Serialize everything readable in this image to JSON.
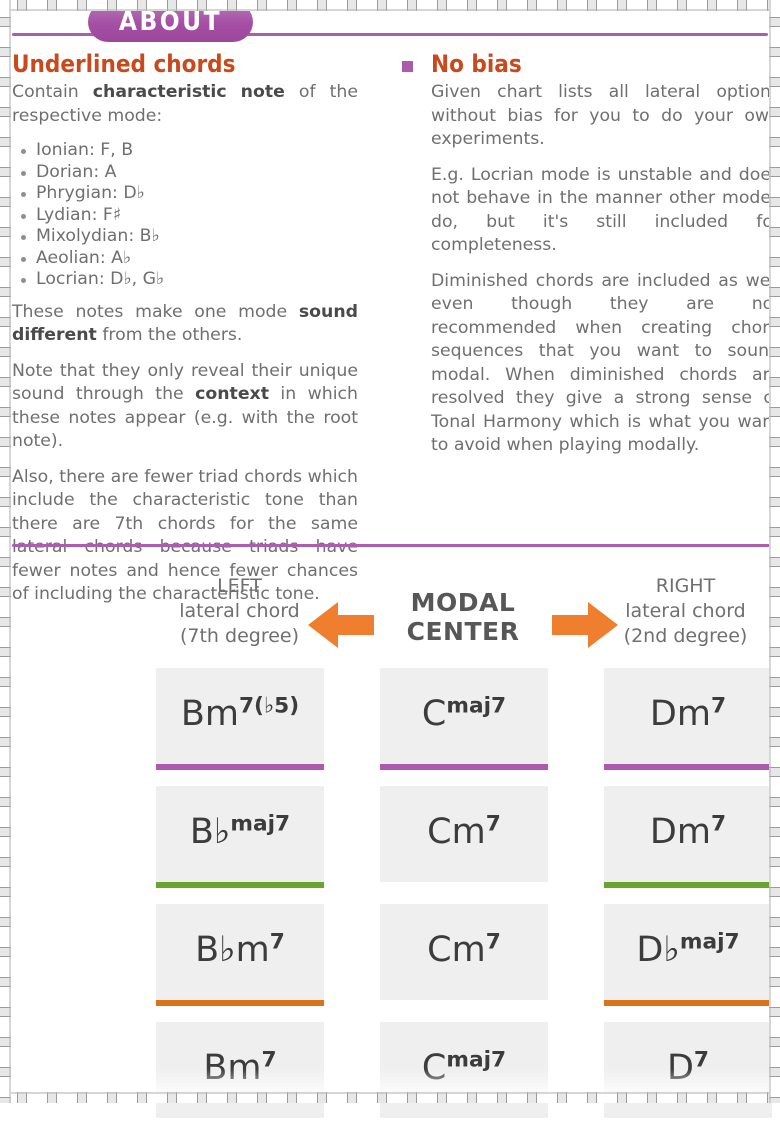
{
  "banner": {
    "label": "ABOUT"
  },
  "left_column": {
    "heading": "Underlined chords",
    "intro_a": "Contain ",
    "intro_bold1": "characteristic",
    "intro_mid": " ",
    "intro_bold2": "note",
    "intro_b": " of the respective mode:",
    "modes": [
      "Ionian: F, B",
      "Dorian: A",
      "Phrygian: D♭",
      "Lydian: F♯",
      "Mixolydian: B♭",
      "Aeolian: A♭",
      "Locrian: D♭, G♭"
    ],
    "p2_a": "These notes make one mode ",
    "p2_bold": "sound different",
    "p2_b": " from the others.",
    "p3_a": "Note that they only reveal their unique sound through the ",
    "p3_bold": "context",
    "p3_b": " in which these notes appear (e.g. with the root note).",
    "p4": "Also, there are fewer triad chords which include the characteristic tone than there are 7th chords for the same lateral chords because triads have fewer notes and hence fewer chances of including the characteristic tone."
  },
  "right_column": {
    "heading": "No bias",
    "p1": "Given chart lists all lateral options without bias for you to do your own experiments.",
    "p2": "E.g. Locrian mode is unstable and does not behave in the manner other modes do, but it's still included for completeness.",
    "p3": "Diminished chords are included as well even though they are not recommended when creating chord sequences that you want to sound modal. When diminished chords are resolved they give a strong sense of Tonal Harmony which is what you want to avoid when playing modally."
  },
  "chart_header": {
    "left_line1": "LEFT",
    "left_line2": "lateral chord",
    "left_line3": "(7th degree)",
    "center_line1": "MODAL",
    "center_line2": "CENTER",
    "right_line1": "RIGHT",
    "right_line2": "lateral chord",
    "right_line3": "(2nd degree)"
  },
  "colors": {
    "purple": "#ab5bab",
    "green": "#6aa331",
    "orange": "#d9741c",
    "arrow_orange": "#ef7f2f",
    "heading_orange": "#c9491d",
    "card_bg": "#efefef",
    "body_text": "#6f6f6f"
  },
  "chord_grid": {
    "rows": [
      {
        "cells": [
          {
            "root": "Bm",
            "sup": "7(♭5)",
            "underline": "#ab5bab"
          },
          {
            "root": "C",
            "sup": "maj7",
            "underline": "#ab5bab"
          },
          {
            "root": "Dm",
            "sup": "7",
            "underline": "#ab5bab"
          }
        ]
      },
      {
        "cells": [
          {
            "root": "B♭",
            "sup": "maj7",
            "underline": "#6aa331"
          },
          {
            "root": "Cm",
            "sup": "7",
            "underline": "none"
          },
          {
            "root": "Dm",
            "sup": "7",
            "underline": "#6aa331"
          }
        ]
      },
      {
        "cells": [
          {
            "root": "B♭m",
            "sup": "7",
            "underline": "#d9741c"
          },
          {
            "root": "Cm",
            "sup": "7",
            "underline": "none"
          },
          {
            "root": "D♭",
            "sup": "maj7",
            "underline": "#d9741c"
          }
        ]
      },
      {
        "cells": [
          {
            "root": "Bm",
            "sup": "7",
            "underline": "none"
          },
          {
            "root": "C",
            "sup": "maj7",
            "underline": "none"
          },
          {
            "root": "D",
            "sup": "7",
            "underline": "none"
          }
        ]
      }
    ]
  }
}
